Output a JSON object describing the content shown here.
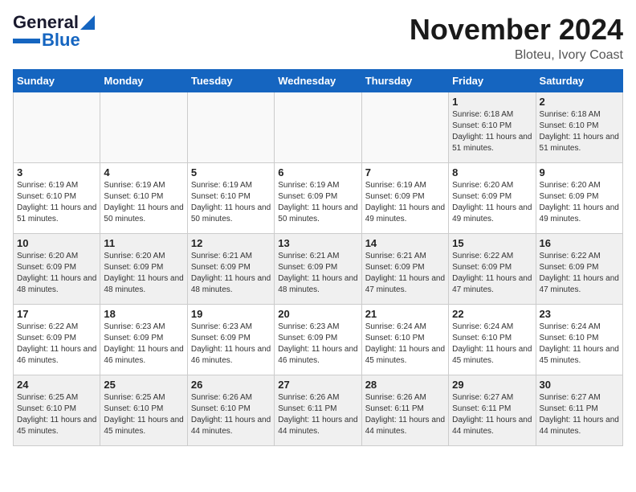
{
  "header": {
    "logo_line1": "General",
    "logo_line2": "Blue",
    "title": "November 2024",
    "location": "Bloteu, Ivory Coast"
  },
  "weekdays": [
    "Sunday",
    "Monday",
    "Tuesday",
    "Wednesday",
    "Thursday",
    "Friday",
    "Saturday"
  ],
  "weeks": [
    [
      {
        "day": "",
        "info": ""
      },
      {
        "day": "",
        "info": ""
      },
      {
        "day": "",
        "info": ""
      },
      {
        "day": "",
        "info": ""
      },
      {
        "day": "",
        "info": ""
      },
      {
        "day": "1",
        "info": "Sunrise: 6:18 AM\nSunset: 6:10 PM\nDaylight: 11 hours and 51 minutes."
      },
      {
        "day": "2",
        "info": "Sunrise: 6:18 AM\nSunset: 6:10 PM\nDaylight: 11 hours and 51 minutes."
      }
    ],
    [
      {
        "day": "3",
        "info": "Sunrise: 6:19 AM\nSunset: 6:10 PM\nDaylight: 11 hours and 51 minutes."
      },
      {
        "day": "4",
        "info": "Sunrise: 6:19 AM\nSunset: 6:10 PM\nDaylight: 11 hours and 50 minutes."
      },
      {
        "day": "5",
        "info": "Sunrise: 6:19 AM\nSunset: 6:10 PM\nDaylight: 11 hours and 50 minutes."
      },
      {
        "day": "6",
        "info": "Sunrise: 6:19 AM\nSunset: 6:09 PM\nDaylight: 11 hours and 50 minutes."
      },
      {
        "day": "7",
        "info": "Sunrise: 6:19 AM\nSunset: 6:09 PM\nDaylight: 11 hours and 49 minutes."
      },
      {
        "day": "8",
        "info": "Sunrise: 6:20 AM\nSunset: 6:09 PM\nDaylight: 11 hours and 49 minutes."
      },
      {
        "day": "9",
        "info": "Sunrise: 6:20 AM\nSunset: 6:09 PM\nDaylight: 11 hours and 49 minutes."
      }
    ],
    [
      {
        "day": "10",
        "info": "Sunrise: 6:20 AM\nSunset: 6:09 PM\nDaylight: 11 hours and 48 minutes."
      },
      {
        "day": "11",
        "info": "Sunrise: 6:20 AM\nSunset: 6:09 PM\nDaylight: 11 hours and 48 minutes."
      },
      {
        "day": "12",
        "info": "Sunrise: 6:21 AM\nSunset: 6:09 PM\nDaylight: 11 hours and 48 minutes."
      },
      {
        "day": "13",
        "info": "Sunrise: 6:21 AM\nSunset: 6:09 PM\nDaylight: 11 hours and 48 minutes."
      },
      {
        "day": "14",
        "info": "Sunrise: 6:21 AM\nSunset: 6:09 PM\nDaylight: 11 hours and 47 minutes."
      },
      {
        "day": "15",
        "info": "Sunrise: 6:22 AM\nSunset: 6:09 PM\nDaylight: 11 hours and 47 minutes."
      },
      {
        "day": "16",
        "info": "Sunrise: 6:22 AM\nSunset: 6:09 PM\nDaylight: 11 hours and 47 minutes."
      }
    ],
    [
      {
        "day": "17",
        "info": "Sunrise: 6:22 AM\nSunset: 6:09 PM\nDaylight: 11 hours and 46 minutes."
      },
      {
        "day": "18",
        "info": "Sunrise: 6:23 AM\nSunset: 6:09 PM\nDaylight: 11 hours and 46 minutes."
      },
      {
        "day": "19",
        "info": "Sunrise: 6:23 AM\nSunset: 6:09 PM\nDaylight: 11 hours and 46 minutes."
      },
      {
        "day": "20",
        "info": "Sunrise: 6:23 AM\nSunset: 6:09 PM\nDaylight: 11 hours and 46 minutes."
      },
      {
        "day": "21",
        "info": "Sunrise: 6:24 AM\nSunset: 6:10 PM\nDaylight: 11 hours and 45 minutes."
      },
      {
        "day": "22",
        "info": "Sunrise: 6:24 AM\nSunset: 6:10 PM\nDaylight: 11 hours and 45 minutes."
      },
      {
        "day": "23",
        "info": "Sunrise: 6:24 AM\nSunset: 6:10 PM\nDaylight: 11 hours and 45 minutes."
      }
    ],
    [
      {
        "day": "24",
        "info": "Sunrise: 6:25 AM\nSunset: 6:10 PM\nDaylight: 11 hours and 45 minutes."
      },
      {
        "day": "25",
        "info": "Sunrise: 6:25 AM\nSunset: 6:10 PM\nDaylight: 11 hours and 45 minutes."
      },
      {
        "day": "26",
        "info": "Sunrise: 6:26 AM\nSunset: 6:10 PM\nDaylight: 11 hours and 44 minutes."
      },
      {
        "day": "27",
        "info": "Sunrise: 6:26 AM\nSunset: 6:11 PM\nDaylight: 11 hours and 44 minutes."
      },
      {
        "day": "28",
        "info": "Sunrise: 6:26 AM\nSunset: 6:11 PM\nDaylight: 11 hours and 44 minutes."
      },
      {
        "day": "29",
        "info": "Sunrise: 6:27 AM\nSunset: 6:11 PM\nDaylight: 11 hours and 44 minutes."
      },
      {
        "day": "30",
        "info": "Sunrise: 6:27 AM\nSunset: 6:11 PM\nDaylight: 11 hours and 44 minutes."
      }
    ]
  ]
}
